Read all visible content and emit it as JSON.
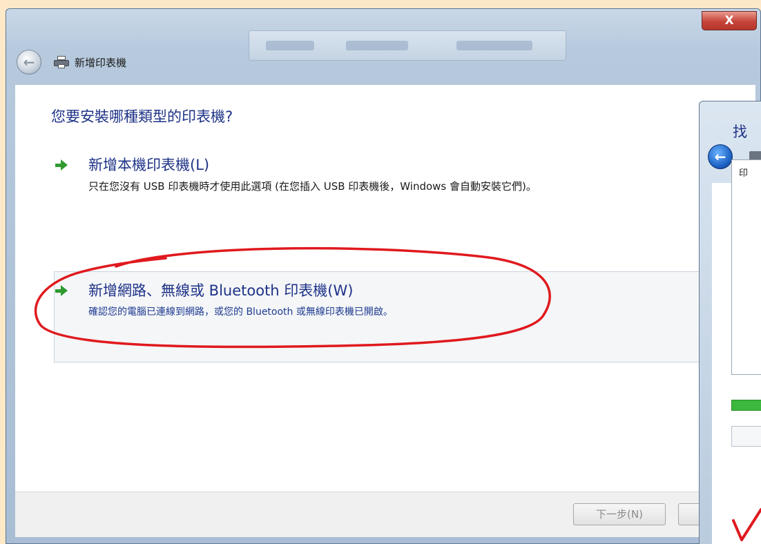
{
  "window": {
    "title": "新增印表機",
    "close_label": "X"
  },
  "main": {
    "heading": "您要安裝哪種類型的印表機?",
    "options": [
      {
        "title": "新增本機印表機(L)",
        "description": "只在您沒有 USB 印表機時才使用此選項 (在您插入 USB 印表機後，Windows 會自動安裝它們)。"
      },
      {
        "title": "新增網路、無線或 Bluetooth 印表機(W)",
        "description": "確認您的電腦已連線到網路，或您的 Bluetooth 或無線印表機已開啟。"
      }
    ]
  },
  "footer": {
    "next_label": "下一步(N)",
    "cancel_label": ""
  },
  "background_window": {
    "heading_fragment": "找",
    "list_column_fragment": "印"
  },
  "annotations": {
    "circle_color": "#e0191e",
    "check_color": "#e0191e"
  },
  "icons": [
    "back-arrow-icon",
    "printer-icon",
    "green-arrow-icon",
    "close-icon"
  ]
}
